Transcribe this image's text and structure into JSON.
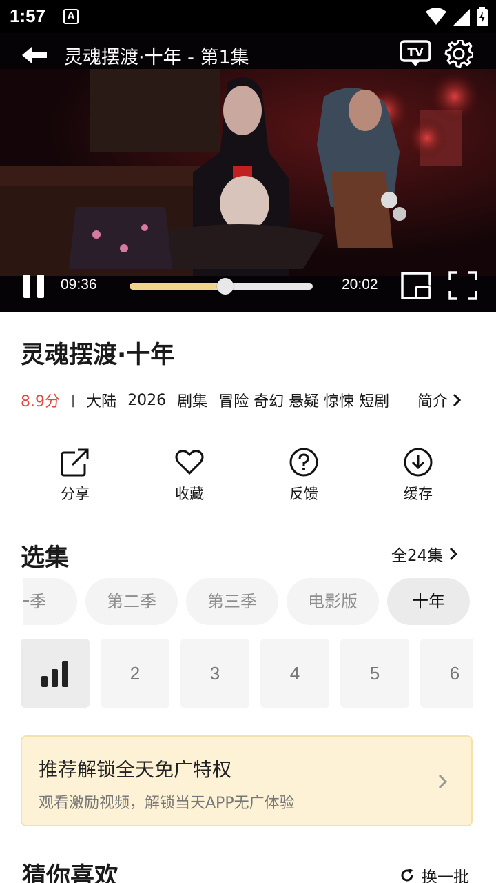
{
  "status_bar": {
    "time": "1:57",
    "notification_letter": "A"
  },
  "player": {
    "title": "灵魂摆渡·十年 - 第1集",
    "current_time": "09:36",
    "total_time": "20:02",
    "progress_fraction": 0.479,
    "tv_label": "TV"
  },
  "info": {
    "title": "灵魂摆渡·十年",
    "rating": "8.9分",
    "separator": "|",
    "region": "大陆",
    "year": "2026",
    "category": "剧集",
    "tags": "冒险 奇幻 悬疑 惊悚 短剧",
    "intro_label": "简介"
  },
  "actions": [
    {
      "label": "分享",
      "icon": "share-icon"
    },
    {
      "label": "收藏",
      "icon": "heart-icon"
    },
    {
      "label": "反馈",
      "icon": "question-icon"
    },
    {
      "label": "缓存",
      "icon": "download-icon"
    }
  ],
  "episodes_section": {
    "title": "选集",
    "all_label": "全24集",
    "seasons": [
      "一季",
      "第二季",
      "第三季",
      "电影版",
      "十年"
    ],
    "active_season": 4,
    "episodes": [
      "1",
      "2",
      "3",
      "4",
      "5",
      "6"
    ],
    "playing_icon": "playing-bars-icon"
  },
  "promo": {
    "title": "推荐解锁全天免广特权",
    "subtitle": "观看激励视频，解锁当天APP无广体验"
  },
  "recommend": {
    "title": "猜你喜欢",
    "refresh_label": "换一批"
  },
  "colors": {
    "rating": "#e5483b",
    "progress": "#f0d48a",
    "promo_bg": "#fdf2d6"
  }
}
